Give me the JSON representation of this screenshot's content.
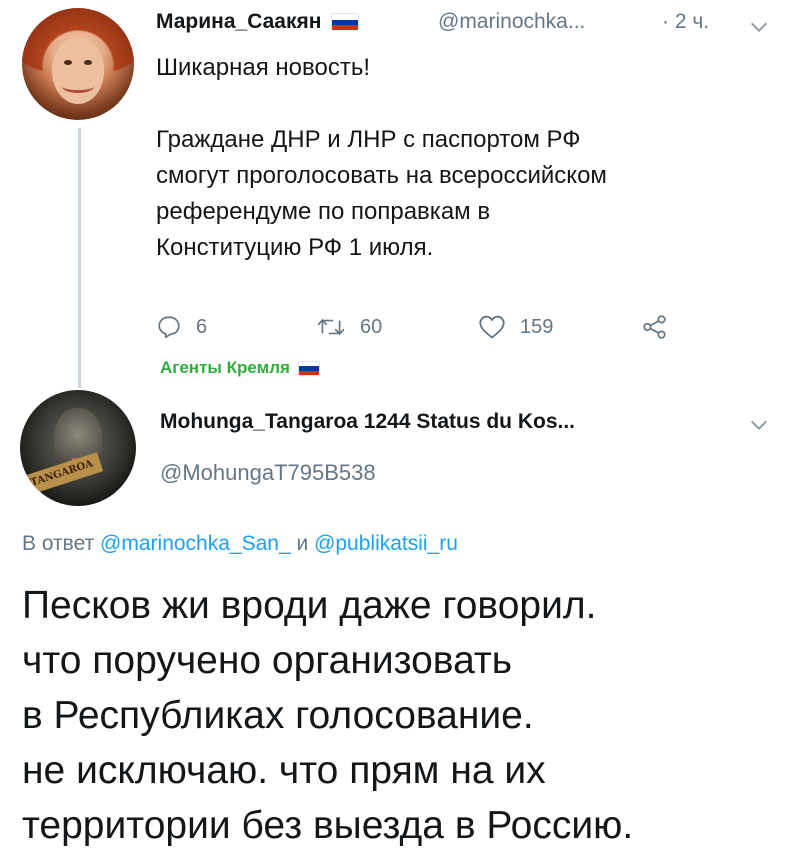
{
  "tweet1": {
    "author_name": "Марина_Саакян",
    "author_flag": "flag-russia",
    "handle": "@marinochka...",
    "separator": "·",
    "time": "2 ч.",
    "text_lines": {
      "l1": "Шикарная новость!",
      "l2": "Граждане ДНР и ЛНР с паспортом РФ",
      "l3": "смогут проголосовать на всероссийском",
      "l4": "референдуме по поправкам в",
      "l5": "Конституцию РФ 1 июля."
    },
    "actions": {
      "replies": "6",
      "retweets": "60",
      "likes": "159"
    },
    "list_label": "Агенты Кремля"
  },
  "tweet2": {
    "author_name": "Mohunga_Tangaroa 1244 Status du Kos...",
    "handle": "@MohungaT795B538",
    "avatar_banner": "TANGAROA",
    "reply_prefix": "В ответ",
    "reply_mention1": "@marinochka_San_",
    "reply_and": "и",
    "reply_mention2": "@publikatsii_ru",
    "text_lines": {
      "l1": "Песков жи вроди даже говорил.",
      "l2": "что поручено организовать",
      "l3": "в Республиках голосование.",
      "l4": "не исключаю. что прям на их",
      "l5": "территории без выезда в Россию."
    }
  },
  "icons": {
    "reply": "reply-icon",
    "retweet": "retweet-icon",
    "like": "heart-icon",
    "share": "share-icon",
    "menu": "chevron-down-icon"
  },
  "colors": {
    "text": "#14171a",
    "secondary": "#657786",
    "link": "#1da1f2",
    "list_label": "#2fae3d",
    "thread_line": "#ccd6dd",
    "flag_white": "#ffffff",
    "flag_blue": "#0039a6",
    "flag_red": "#d52b1e"
  }
}
